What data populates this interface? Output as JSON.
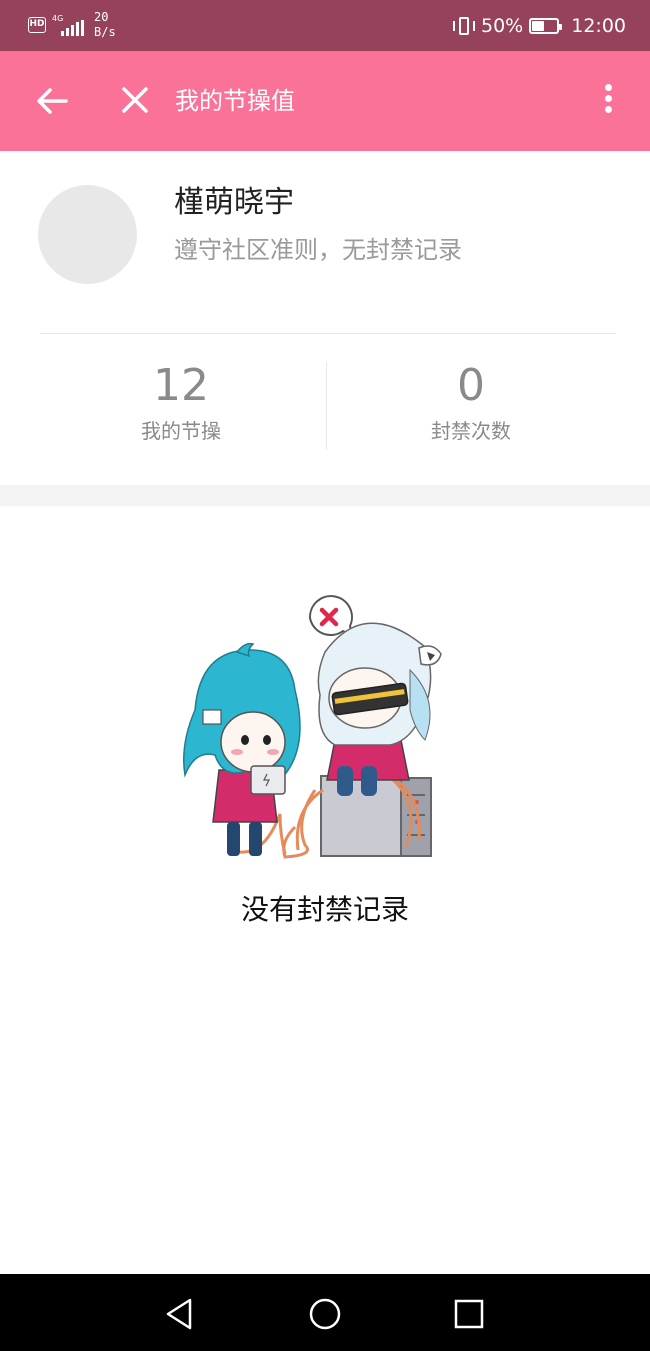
{
  "status_bar": {
    "hd": "HD",
    "network": "4G",
    "speed_value": "20",
    "speed_unit": "B/s",
    "battery_percent": "50%",
    "battery_level": 0.5,
    "time": "12:00"
  },
  "app_bar": {
    "title": "我的节操值",
    "back_icon": "arrow-left-icon",
    "close_icon": "close-icon",
    "more_icon": "more-vertical-icon"
  },
  "profile": {
    "name": "槿萌晓宇",
    "status": "遵守社区准则，无封禁记录"
  },
  "stats": [
    {
      "value": "12",
      "label": "我的节操"
    },
    {
      "value": "0",
      "label": "封禁次数"
    }
  ],
  "empty_state": {
    "message": "没有封禁记录"
  },
  "nav_bar": {
    "back_icon": "triangle-back-icon",
    "home_icon": "circle-home-icon",
    "recent_icon": "square-recent-icon"
  },
  "colors": {
    "status_bar_bg": "#95425a",
    "app_bar_bg": "#fb7299",
    "gap_band": "#f4f4f4"
  }
}
